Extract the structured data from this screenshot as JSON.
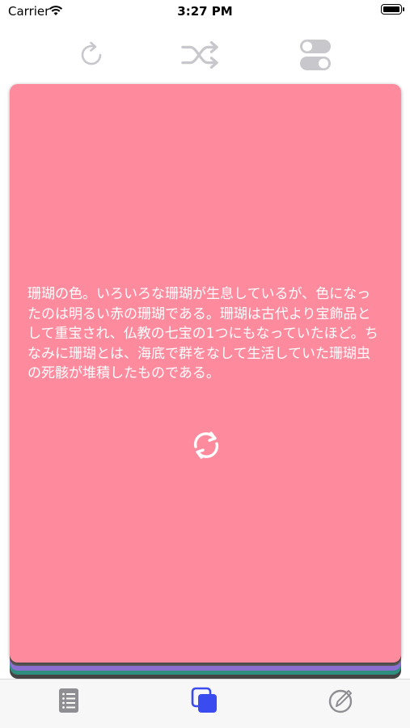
{
  "status_bar": {
    "carrier": "Carrier",
    "time": "3:27 PM"
  },
  "toolbar": {
    "icons": [
      "refresh-icon",
      "shuffle-icon",
      "toggle-settings-icon"
    ],
    "icon_color": "#c7c7cc"
  },
  "card": {
    "background": "#fe8a9e",
    "text": "珊瑚の色。いろいろな珊瑚が生息しているが、色になったのは明るい赤の珊瑚である。珊瑚は古代より宝飾品として重宝され、仏教の七宝の1つにもなっていたほど。ちなみに珊瑚とは、海底で群をなして生活していた珊瑚虫の死骸が堆積したものである。",
    "stack_colors": [
      "#444444",
      "#2f8f7f",
      "#8a6fd0",
      "#d2b34c",
      "#5a5a5a"
    ]
  },
  "tab_bar": {
    "tabs": [
      {
        "icon": "list-icon",
        "selected": false
      },
      {
        "icon": "cards-icon",
        "selected": true
      },
      {
        "icon": "edit-icon",
        "selected": false
      }
    ],
    "selected_color": "#3a4bf0",
    "inactive_color": "#8e8e93"
  }
}
